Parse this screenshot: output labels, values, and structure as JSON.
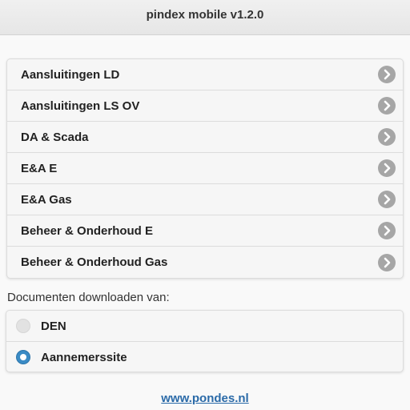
{
  "header": {
    "title": "pindex mobile v1.2.0"
  },
  "menu": {
    "items": [
      {
        "label": "Aansluitingen LD",
        "icon": "chevron-right-icon"
      },
      {
        "label": "Aansluitingen LS OV",
        "icon": "chevron-right-icon"
      },
      {
        "label": "DA & Scada",
        "icon": "chevron-right-icon"
      },
      {
        "label": "E&A E",
        "icon": "chevron-right-icon"
      },
      {
        "label": "E&A Gas",
        "icon": "chevron-right-icon"
      },
      {
        "label": "Beheer & Onderhoud E",
        "icon": "chevron-right-icon"
      },
      {
        "label": "Beheer & Onderhoud Gas",
        "icon": "chevron-right-icon"
      }
    ]
  },
  "download": {
    "label": "Documenten downloaden van:",
    "options": [
      {
        "label": "DEN",
        "selected": false
      },
      {
        "label": "Aannemerssite",
        "selected": true
      }
    ]
  },
  "footer": {
    "link_text": "www.pondes.nl"
  },
  "colors": {
    "accent": "#3a8bc5",
    "link": "#2a6aa8",
    "chevron_bg": "#a6a6a6"
  }
}
